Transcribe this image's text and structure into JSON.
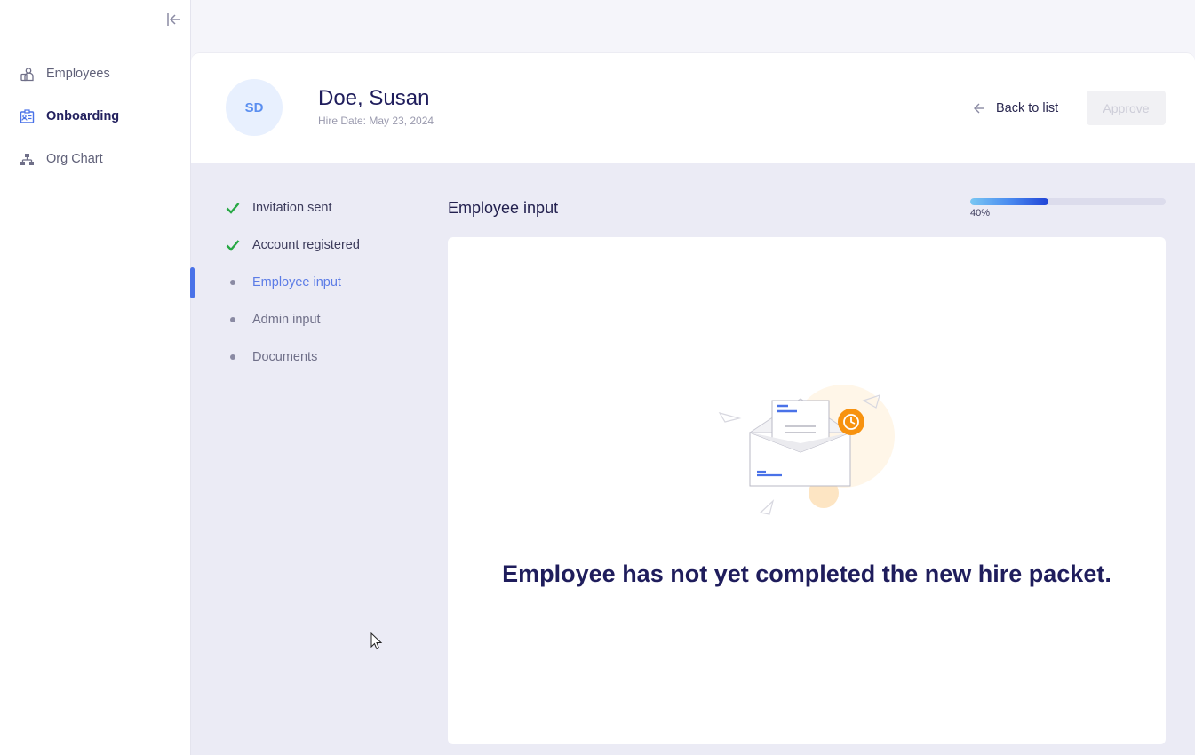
{
  "sidebar": {
    "items": [
      {
        "label": "Employees",
        "icon": "employees-icon"
      },
      {
        "label": "Onboarding",
        "icon": "onboarding-icon",
        "active": true
      },
      {
        "label": "Org Chart",
        "icon": "org-chart-icon"
      }
    ]
  },
  "employee": {
    "initials": "SD",
    "name": "Doe, Susan",
    "hire_date": "Hire Date: May 23, 2024"
  },
  "header": {
    "back_label": "Back to list",
    "approve_label": "Approve"
  },
  "steps": [
    {
      "label": "Invitation sent",
      "status": "done"
    },
    {
      "label": "Account registered",
      "status": "done"
    },
    {
      "label": "Employee input",
      "status": "current"
    },
    {
      "label": "Admin input",
      "status": "pending"
    },
    {
      "label": "Documents",
      "status": "pending"
    }
  ],
  "section": {
    "title": "Employee input",
    "progress_label": "40%",
    "progress_percent": 40
  },
  "empty_state": {
    "message": "Employee has not yet completed the new hire packet."
  },
  "colors": {
    "accent": "#4a72e8",
    "check": "#27a844",
    "title": "#1f1d5c",
    "clock": "#f7920f"
  }
}
